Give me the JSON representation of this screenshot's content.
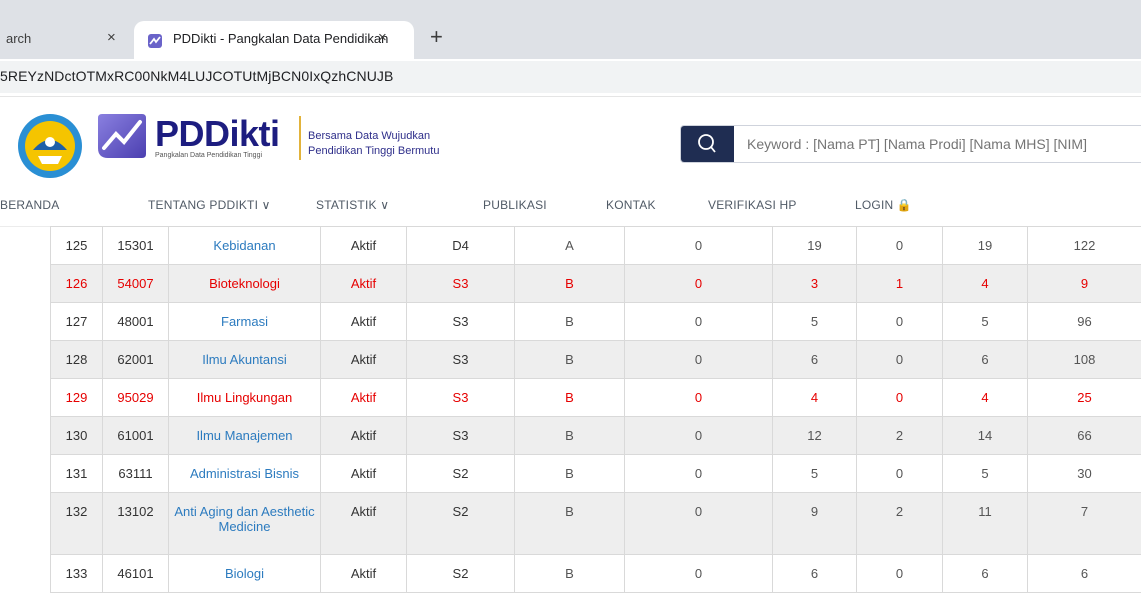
{
  "browser": {
    "tab_inactive_title": "arch",
    "tab_active_title": "PDDikti - Pangkalan Data Pendidikan Tinggi",
    "tab_close_glyph": "×",
    "new_tab_glyph": "+",
    "url": "5REYzNDctOTMxRC00NkM4LUJCOTUtMjBCN0IxQzhCNUJB"
  },
  "header": {
    "brand_name": "PDDikti",
    "brand_subtitle": "Pangkalan Data Pendidikan Tinggi",
    "tagline_line1": "Bersama Data Wujudkan",
    "tagline_line2": "Pendidikan Tinggi Bermutu",
    "search_placeholder": "Keyword : [Nama PT] [Nama Prodi] [Nama MHS] [NIM]"
  },
  "nav": {
    "items": [
      {
        "label": "BERANDA"
      },
      {
        "label": "TENTANG PDDIKTI ∨"
      },
      {
        "label": "STATISTIK ∨"
      },
      {
        "label": "PUBLIKASI"
      },
      {
        "label": "KONTAK"
      },
      {
        "label": "VERIFIKASI HP"
      },
      {
        "label": "LOGIN 🔒"
      }
    ]
  },
  "colors": {
    "highlight": "#e60000",
    "link": "#2c7bbf",
    "brand": "#1d1d80",
    "accent": "#e2b33b"
  },
  "table": {
    "rows": [
      [
        "125",
        "15301",
        "Kebidanan",
        "Aktif",
        "D4",
        "A",
        "0",
        "19",
        "0",
        "19",
        "122"
      ],
      [
        "126",
        "54007",
        "Bioteknologi",
        "Aktif",
        "S3",
        "B",
        "0",
        "3",
        "1",
        "4",
        "9"
      ],
      [
        "127",
        "48001",
        "Farmasi",
        "Aktif",
        "S3",
        "B",
        "0",
        "5",
        "0",
        "5",
        "96"
      ],
      [
        "128",
        "62001",
        "Ilmu Akuntansi",
        "Aktif",
        "S3",
        "B",
        "0",
        "6",
        "0",
        "6",
        "108"
      ],
      [
        "129",
        "95029",
        "Ilmu Lingkungan",
        "Aktif",
        "S3",
        "B",
        "0",
        "4",
        "0",
        "4",
        "25"
      ],
      [
        "130",
        "61001",
        "Ilmu Manajemen",
        "Aktif",
        "S3",
        "B",
        "0",
        "12",
        "2",
        "14",
        "66"
      ],
      [
        "131",
        "63111",
        "Administrasi Bisnis",
        "Aktif",
        "S2",
        "B",
        "0",
        "5",
        "0",
        "5",
        "30"
      ],
      [
        "132",
        "13102",
        "Anti Aging dan Aesthetic Medicine",
        "Aktif",
        "S2",
        "B",
        "0",
        "9",
        "2",
        "11",
        "7"
      ],
      [
        "133",
        "46101",
        "Biologi",
        "Aktif",
        "S2",
        "B",
        "0",
        "6",
        "0",
        "6",
        "6"
      ]
    ],
    "highlighted_rows": [
      "126",
      "129"
    ]
  }
}
